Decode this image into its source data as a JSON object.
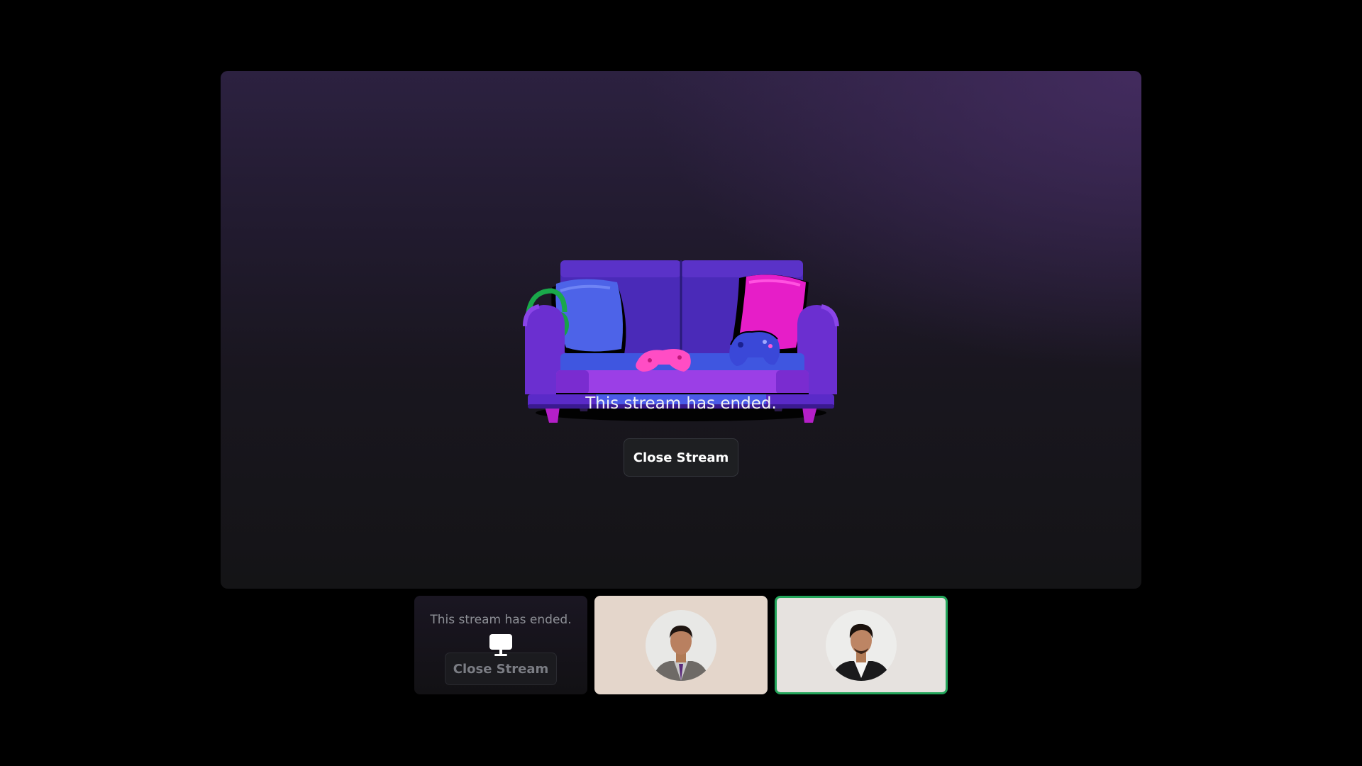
{
  "stage": {
    "message": "This stream has ended.",
    "close_button_label": "Close Stream"
  },
  "tiles": {
    "stream": {
      "message": "This stream has ended.",
      "close_button_label": "Close Stream",
      "icon": "monitor-icon"
    },
    "participants": [
      {
        "avatar": "user-avatar",
        "speaking": false
      },
      {
        "avatar": "user-avatar",
        "speaking": true
      }
    ]
  },
  "colors": {
    "background": "#000000",
    "speaking_border": "#23a55a",
    "button_bg": "#1e1f22",
    "text": "#f2f3f5"
  }
}
